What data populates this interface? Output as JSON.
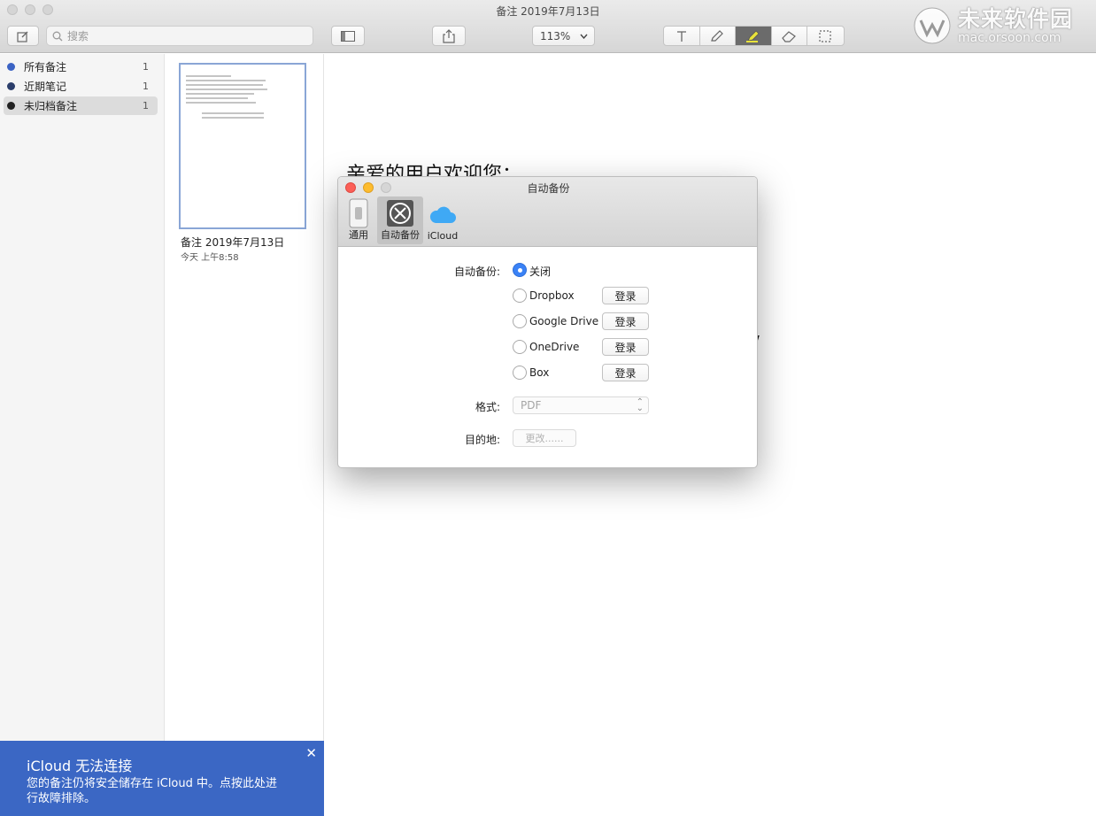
{
  "window": {
    "title": "备注 2019年7月13日",
    "search_placeholder": "搜索",
    "zoom": "113%"
  },
  "watermark": {
    "cn": "未来软件园",
    "en": "mac.orsoon.com"
  },
  "sidebar": {
    "folders": [
      {
        "label": "所有备注",
        "count": "1",
        "color": "#3b63c4"
      },
      {
        "label": "近期笔记",
        "count": "1",
        "color": "#2b3e6b"
      },
      {
        "label": "未归档备注",
        "count": "1",
        "color": "#222222"
      }
    ],
    "add_label": "+⌄"
  },
  "icloud_banner": {
    "title": "iCloud 无法连接",
    "message": "您的备注仍将安全储存在 iCloud 中。点按此处进行故障排除。",
    "close": "✕"
  },
  "note_list": {
    "items": [
      {
        "title": "备注 2019年7月13日",
        "date": "今天 上午8:58"
      }
    ]
  },
  "document": {
    "heading": "亲爱的用户欢迎您：",
    "fragment": "/"
  },
  "dialog": {
    "title": "自动备份",
    "tabs": [
      {
        "label": "通用"
      },
      {
        "label": "自动备份"
      },
      {
        "label": "iCloud"
      }
    ],
    "backup_label": "自动备份:",
    "options": [
      {
        "label": "关闭",
        "checked": true,
        "login": ""
      },
      {
        "label": "Dropbox",
        "checked": false,
        "login": "登录"
      },
      {
        "label": "Google Drive",
        "checked": false,
        "login": "登录"
      },
      {
        "label": "OneDrive",
        "checked": false,
        "login": "登录"
      },
      {
        "label": "Box",
        "checked": false,
        "login": "登录"
      }
    ],
    "format_label": "格式:",
    "format_value": "PDF",
    "destination_label": "目的地:",
    "change_label": "更改......"
  }
}
